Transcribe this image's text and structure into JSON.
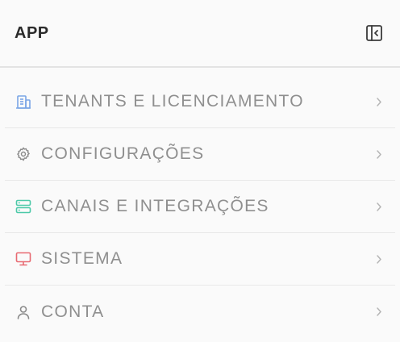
{
  "header": {
    "title": "APP",
    "collapse_icon": "sidebar-collapse-icon"
  },
  "colors": {
    "tenants": "#7ba6e6",
    "config": "#8a8a8a",
    "canais": "#4cc9a8",
    "sistema": "#e86a72",
    "conta": "#8a8a8a",
    "label": "#8f8f8f",
    "chevron": "#b5b5b5"
  },
  "menu": {
    "items": [
      {
        "label": "TENANTS E LICENCIAMENTO",
        "icon": "building-icon"
      },
      {
        "label": "CONFIGURAÇÕES",
        "icon": "gear-icon"
      },
      {
        "label": "CANAIS E INTEGRAÇÕES",
        "icon": "server-icon"
      },
      {
        "label": "SISTEMA",
        "icon": "monitor-icon"
      },
      {
        "label": "CONTA",
        "icon": "user-icon"
      }
    ]
  }
}
